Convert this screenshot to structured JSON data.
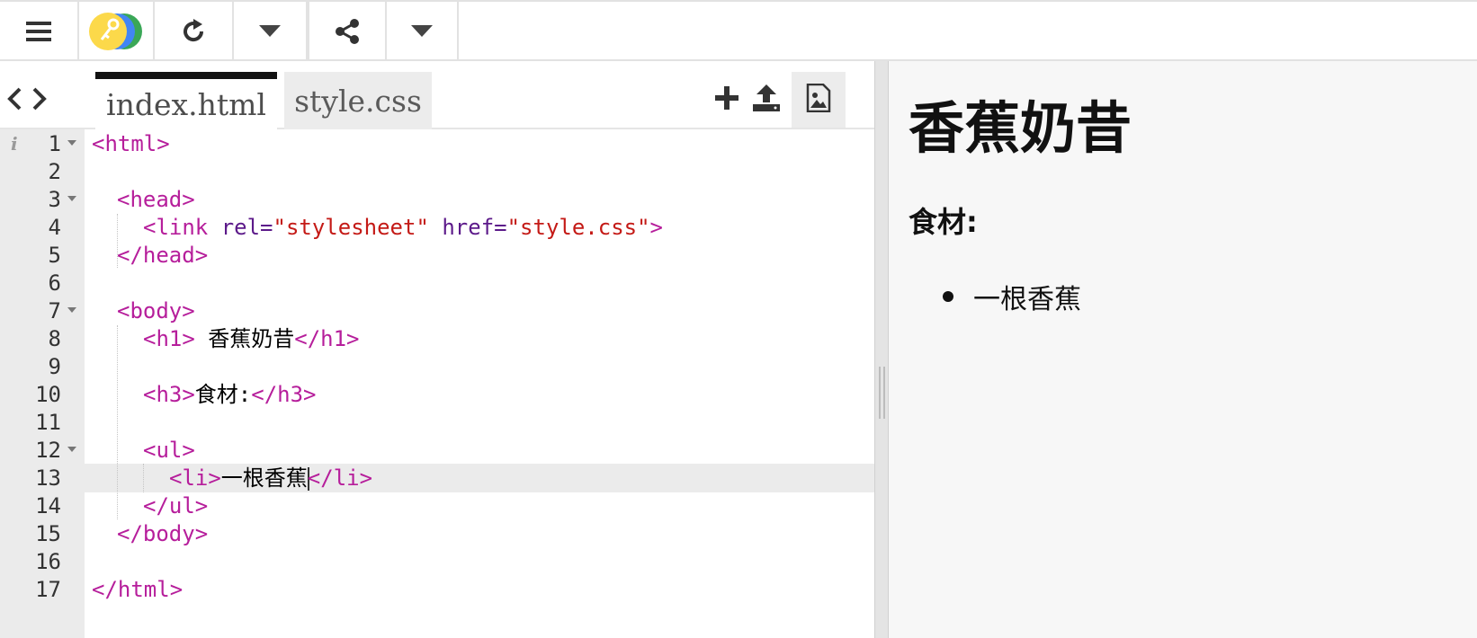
{
  "toolbar": {
    "menu_icon": "hamburger-menu-icon",
    "logo_icon": "key-logo-icon",
    "refresh_icon": "refresh-icon",
    "share_icon": "share-icon",
    "dropdown_icon": "caret-down-icon"
  },
  "editor": {
    "tabs": [
      {
        "label": "index.html",
        "active": true
      },
      {
        "label": "style.css",
        "active": false
      }
    ],
    "tab_actions": [
      "add-file-icon",
      "upload-icon",
      "image-icon"
    ],
    "active_line": 13,
    "lines": [
      {
        "n": "1"
      },
      {
        "n": "2"
      },
      {
        "n": "3"
      },
      {
        "n": "4"
      },
      {
        "n": "5"
      },
      {
        "n": "6"
      },
      {
        "n": "7"
      },
      {
        "n": "8"
      },
      {
        "n": "9"
      },
      {
        "n": "10"
      },
      {
        "n": "11"
      },
      {
        "n": "12"
      },
      {
        "n": "13"
      },
      {
        "n": "14"
      },
      {
        "n": "15"
      },
      {
        "n": "16"
      },
      {
        "n": "17"
      }
    ],
    "code": {
      "l1_open": "<html>",
      "l3_open": "<head>",
      "l4_link": "<link",
      "l4_rel_attr": " rel=",
      "l4_rel_val": "\"stylesheet\"",
      "l4_href_attr": " href=",
      "l4_href_val": "\"style.css\"",
      "l4_close": ">",
      "l5_close": "</head>",
      "l7_open": "<body>",
      "l8_open": "<h1>",
      "l8_text": " 香蕉奶昔",
      "l8_close": "</h1>",
      "l10_open": "<h3>",
      "l10_text": "食材:",
      "l10_close": "</h3>",
      "l12_open": "<ul>",
      "l13_open": "<li>",
      "l13_text": "一根香蕉",
      "l13_close": "</li>",
      "l14_close": "</ul>",
      "l15_close": "</body>",
      "l17_close": "</html>"
    }
  },
  "preview": {
    "h1": "香蕉奶昔",
    "h3": "食材:",
    "list": [
      "一根香蕉"
    ]
  }
}
